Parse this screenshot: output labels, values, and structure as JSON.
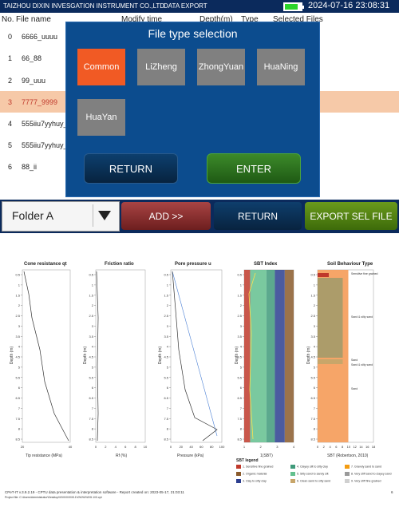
{
  "topbar": {
    "company": "TAIZHOU DIXIN INVESGATION INSTRUMENT CO.,LTD",
    "title": "DATA EXPORT",
    "datetime": "2024-07-16 23:08:31"
  },
  "filelist": {
    "headers": [
      "No.",
      "File name",
      "Modify time",
      "Depth(m)",
      "Type",
      "Selected Files"
    ],
    "rows": [
      {
        "num": "0",
        "name": "6666_uuuu"
      },
      {
        "num": "1",
        "name": "66_88"
      },
      {
        "num": "2",
        "name": "99_uuu"
      },
      {
        "num": "3",
        "name": "7777_9999",
        "selected": true
      },
      {
        "num": "4",
        "name": "555iiu7yyhuy_"
      },
      {
        "num": "5",
        "name": "555iiu7yyhuy_"
      },
      {
        "num": "6",
        "name": "88_ii"
      }
    ]
  },
  "dialog": {
    "title": "File type selection",
    "types": [
      "Common",
      "LiZheng",
      "ZhongYuan",
      "HuaNing",
      "HuaYan"
    ],
    "active_type": "Common",
    "return_label": "RETURN",
    "enter_label": "ENTER"
  },
  "toolbar": {
    "folder_value": "Folder A",
    "add_label": "ADD >>",
    "return_label": "RETURN",
    "export_label": "EXPORT SEL FILE"
  },
  "report": {
    "panels": [
      {
        "title": "Cone resistance qt",
        "xlabel": "Tip resistance (MPa)",
        "ticks": [
          "20",
          "40"
        ]
      },
      {
        "title": "Friction ratio",
        "xlabel": "Rf (%)",
        "ticks": [
          "0",
          "2",
          "4",
          "6",
          "8",
          "10"
        ]
      },
      {
        "title": "Pore pressure u",
        "xlabel": "Pressure (kPa)",
        "ticks": [
          "0",
          "20",
          "40",
          "60",
          "80",
          "100"
        ]
      },
      {
        "title": "SBT Index",
        "xlabel": "1(SBT)",
        "ticks": [
          "1",
          "2",
          "3",
          "4"
        ]
      },
      {
        "title": "Soil Behaviour Type",
        "xlabel": "SBT (Robertson, 2010)",
        "ticks": [
          "0",
          "2",
          "4",
          "6",
          "8",
          "10",
          "12",
          "14",
          "16",
          "18"
        ]
      }
    ],
    "ylabel": "Depth (m)",
    "depth_ticks": [
      "0.5",
      "1",
      "1.5",
      "2",
      "2.5",
      "3",
      "3.5",
      "4",
      "4.5",
      "5",
      "5.5",
      "6",
      "6.5",
      "7",
      "7.5",
      "8",
      "8.5"
    ],
    "sbt_labels": [
      "Sensitive fine grained",
      "Sand & silty sand",
      "Sand",
      "Sand & silty sand",
      "Sand"
    ],
    "legend_title": "SBT legend",
    "legend": [
      {
        "label": "1. Sensitive fine grained",
        "color": "#c0392b"
      },
      {
        "label": "2. Organic material",
        "color": "#8a5a2b"
      },
      {
        "label": "3. Clay to silty clay",
        "color": "#2c3e8f"
      },
      {
        "label": "4. Clayey silt to silty clay",
        "color": "#3f9a7a"
      },
      {
        "label": "5. Silty sand to sandy silt",
        "color": "#63c08e"
      },
      {
        "label": "6. Clean sand to silty sand",
        "color": "#c8a66a"
      },
      {
        "label": "7. Gravely sand to sand",
        "color": "#f39c12"
      },
      {
        "label": "8. Very stiff sand to clayey sand",
        "color": "#9a9a9a"
      },
      {
        "label": "9. Very stiff fine grained",
        "color": "#d0d0d0"
      }
    ],
    "footer_left": "CPeT-IT v.3.9.2.19 - CPTU data presentation & interpretation software - Report created on: 2023-05-17, 21:03:11",
    "footer_project": "Project file: C:\\Users\\Administrator\\Desktop\\\\0\\\\0\\\\0\\\\0\\\\5.1\\\\0\\\\0\\\\0\\\\0\\\\5.1\\\\0.cpt",
    "page_number": "6"
  }
}
